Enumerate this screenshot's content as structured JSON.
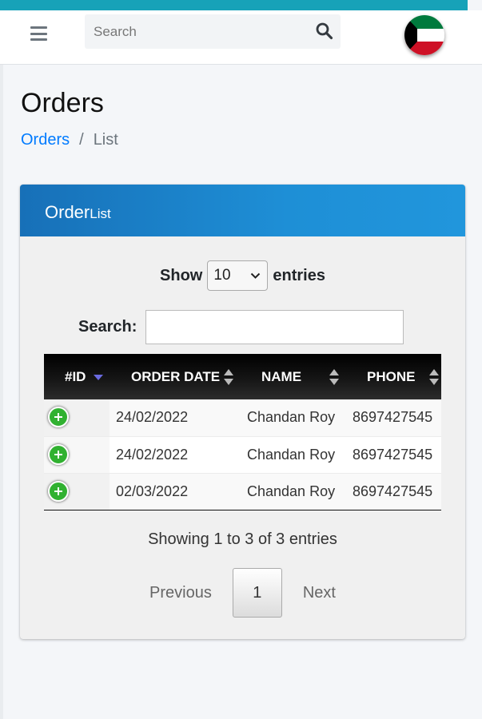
{
  "colors": {
    "top_strip": "#17a2b8",
    "header_gradient_start": "#1770b8",
    "header_gradient_end": "#2196dc",
    "link": "#007bff",
    "expand_button": "#31b131"
  },
  "navbar": {
    "menu_icon": "hamburger-icon",
    "search": {
      "placeholder": "Search",
      "value": "",
      "icon": "search-icon"
    },
    "language_flag": "kuwait-flag-icon"
  },
  "page": {
    "title": "Orders",
    "breadcrumb": [
      {
        "label": "Orders"
      },
      {
        "label": "List"
      }
    ]
  },
  "card": {
    "title_main": "Order",
    "title_sub": "List",
    "length": {
      "prefix": "Show",
      "selected": "10",
      "suffix": "entries"
    },
    "filter": {
      "label": "Search:",
      "value": ""
    },
    "table": {
      "columns": [
        "#ID",
        "ORDER DATE",
        "NAME",
        "PHONE"
      ],
      "rows": [
        {
          "id": "",
          "order_date": "24/02/2022",
          "name": "Chandan Roy",
          "phone": "8697427545"
        },
        {
          "id": "",
          "order_date": "24/02/2022",
          "name": "Chandan Roy",
          "phone": "8697427545"
        },
        {
          "id": "",
          "order_date": "02/03/2022",
          "name": "Chandan Roy",
          "phone": "8697427545"
        }
      ]
    },
    "info": "Showing 1 to 3 of 3 entries",
    "pagination": {
      "previous": "Previous",
      "current": "1",
      "next": "Next"
    }
  }
}
